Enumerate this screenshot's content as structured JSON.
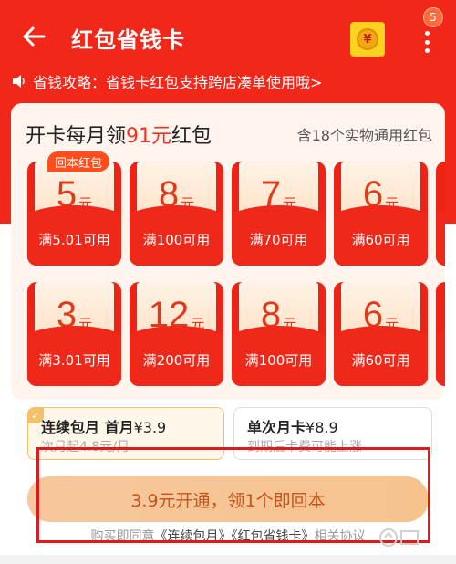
{
  "header": {
    "title": "红包省钱卡",
    "badge_count": "5",
    "coin_symbol": "¥"
  },
  "notice": {
    "text": "省钱攻略：省钱卡红包支持跨店凑单使用哦>"
  },
  "card": {
    "title_prefix": "开卡每月领",
    "title_amount": "91元",
    "title_suffix": "红包",
    "subtitle": "含18个实物通用红包",
    "tag": "回本红包",
    "unit": "元",
    "coupons": [
      {
        "amount": "5",
        "condition": "满5.01可用"
      },
      {
        "amount": "8",
        "condition": "满100可用"
      },
      {
        "amount": "7",
        "condition": "满70可用"
      },
      {
        "amount": "6",
        "condition": "满60可用"
      },
      {
        "amount": "3",
        "condition": "满3.01可用"
      },
      {
        "amount": "12",
        "condition": "满200可用"
      },
      {
        "amount": "8",
        "condition": "满100可用"
      },
      {
        "amount": "6",
        "condition": "满60可用"
      }
    ]
  },
  "plans": [
    {
      "name": "连续包月 首月",
      "price": "¥3.9",
      "note": "次月起4.8元/月",
      "selected": true
    },
    {
      "name": "单次月卡",
      "price": "¥8.9",
      "note": "到期后卡费可能上涨",
      "selected": false
    }
  ],
  "cta": {
    "label": "3.9元开通，领1个即回本"
  },
  "agreement": {
    "prefix": "购买即同意",
    "link1": "《连续包月》",
    "link2": "《红包省钱卡》",
    "suffix": "相关协议"
  },
  "colors": {
    "primary_red": "#f1271a",
    "accent_gold": "#f5c06a",
    "cta_bg": "#f7c79d"
  }
}
